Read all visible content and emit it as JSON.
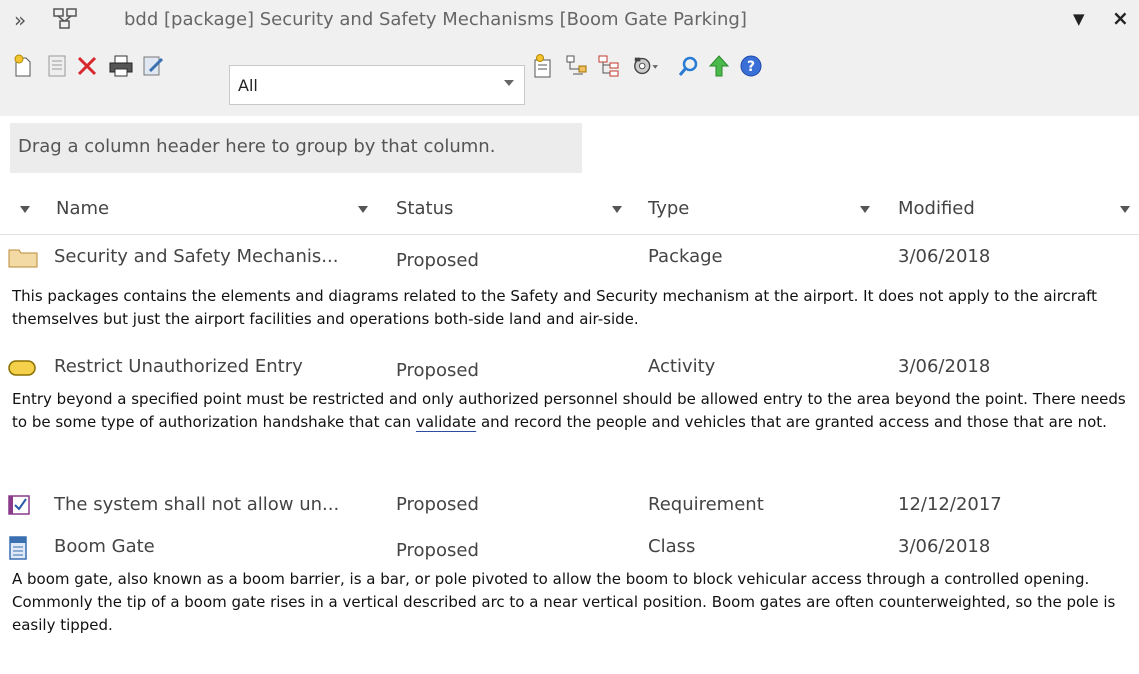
{
  "window": {
    "title": "bdd [package] Security and Safety Mechanisms [Boom Gate Parking]",
    "expand_glyph": "»",
    "pin_glyph": "▼",
    "close_glyph": "×"
  },
  "toolbar": {
    "icons": [
      "new-element-icon",
      "properties-icon",
      "delete-icon",
      "print-icon",
      "edit-notes-icon",
      "tags-icon",
      "hierarchy-icon",
      "tree-icon",
      "options-icon",
      "find-icon",
      "up-icon",
      "help-icon"
    ],
    "filter_value": "All"
  },
  "group_hint": "Drag a column header here to group by that column.",
  "columns": {
    "name": "Name",
    "status": "Status",
    "type": "Type",
    "modified": "Modified"
  },
  "rows": [
    {
      "icon": "package-icon",
      "name": "Security and Safety Mechanis...",
      "status": "Proposed",
      "type": "Package",
      "modified": "3/06/2018",
      "notes": "This packages contains the elements and diagrams related to the Safety and Security mechanism at the airport. It does not apply to the aircraft themselves but just the airport facilities and operations both-side land and air-side."
    },
    {
      "icon": "activity-icon",
      "name": "Restrict Unauthorized Entry",
      "status": "Proposed",
      "type": "Activity",
      "modified": "3/06/2018",
      "notes_pre": "Entry beyond a specified point must be restricted and only authorized personnel should be allowed entry to the area beyond the point. There needs to be some type of authorization handshake that can ",
      "notes_link": "validate",
      "notes_post": " and record the people and vehicles that are granted access and those that are not."
    },
    {
      "icon": "requirement-icon",
      "name": "The system shall not allow un...",
      "status": "Proposed",
      "type": "Requirement",
      "modified": "12/12/2017"
    },
    {
      "icon": "class-icon",
      "name": "Boom Gate",
      "status": "Proposed",
      "type": "Class",
      "modified": "3/06/2018",
      "notes": "A boom gate, also known as a boom barrier, is a bar, or pole pivoted to allow the boom to block vehicular access through a controlled opening. Commonly the tip of a boom gate rises in a vertical described arc to a near vertical position. Boom gates are often counterweighted, so the pole is easily tipped."
    }
  ]
}
